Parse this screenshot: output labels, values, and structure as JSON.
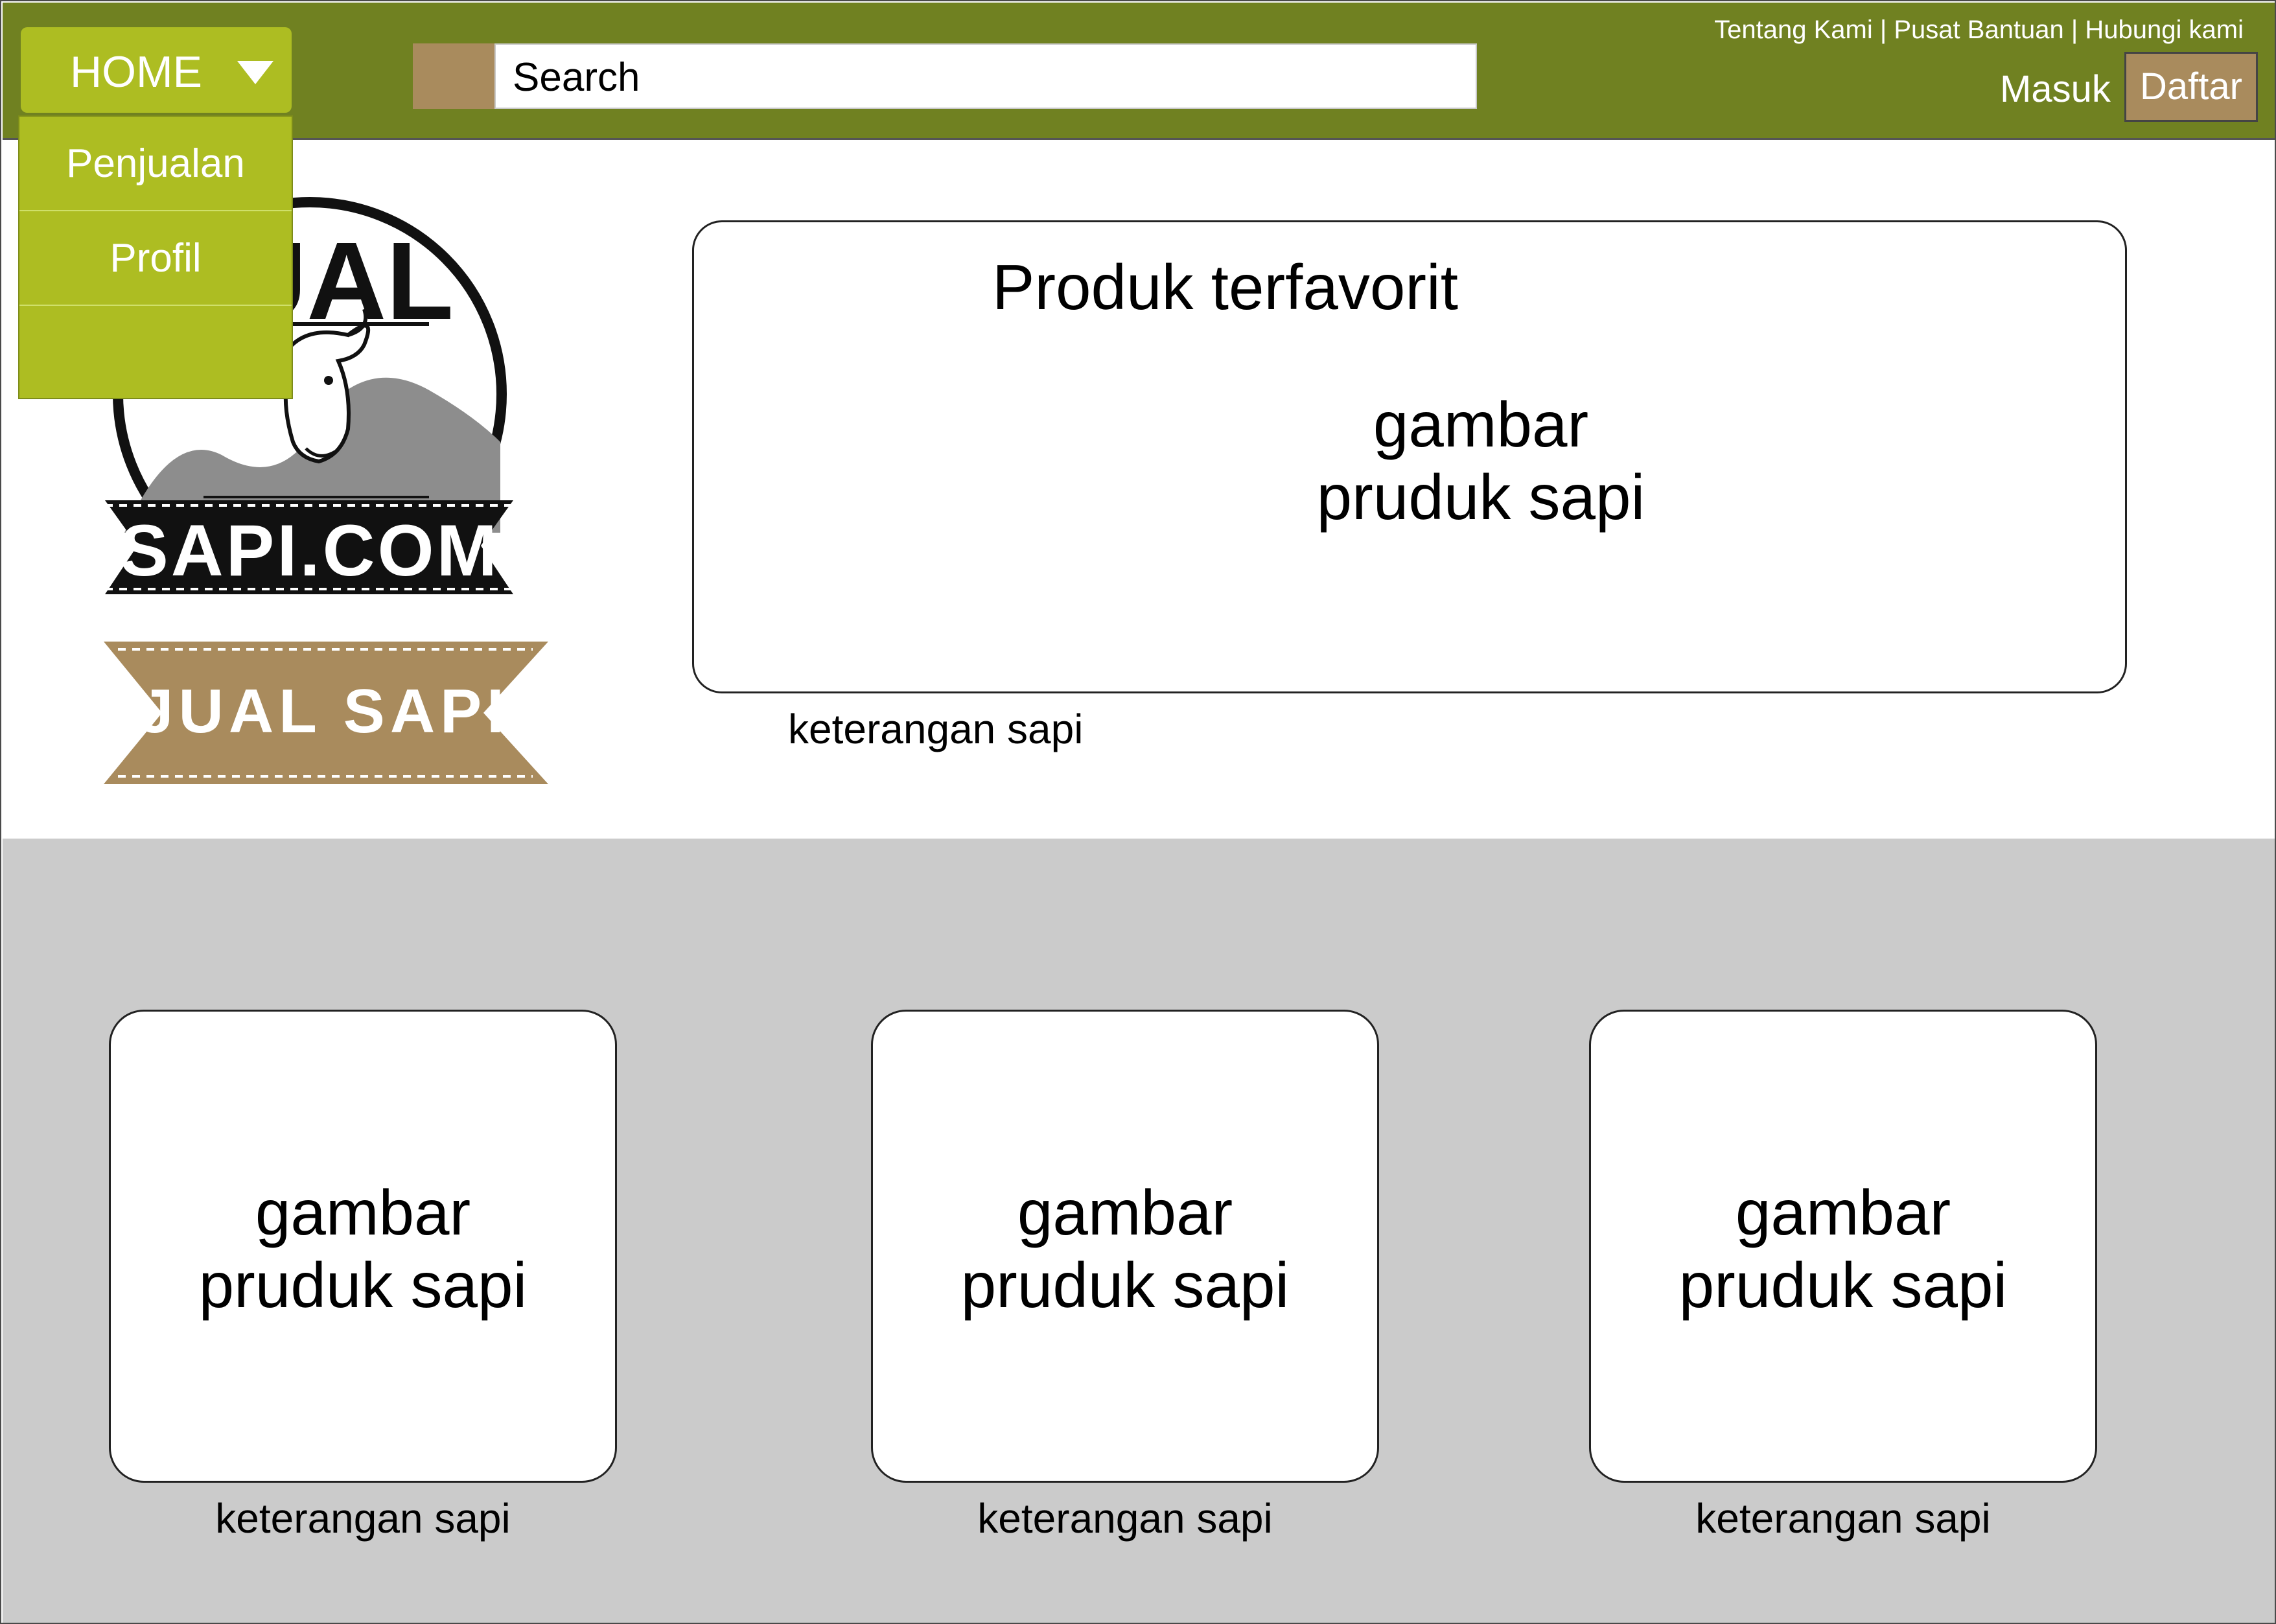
{
  "header": {
    "top_links": [
      "Tentang Kami",
      "Pusat Bantuan",
      "Hubungi kami"
    ],
    "link_separator": " | ",
    "search_placeholder": "Search",
    "login_label": "Masuk",
    "register_label": "Daftar",
    "colors": {
      "bar": "#708121",
      "accent_green": "#adbd22",
      "accent_brown": "#a98b5d"
    }
  },
  "nav": {
    "home_label": "HOME",
    "home_icon": "caret-down-icon",
    "dropdown_items": [
      "Penjualan",
      "Profil",
      ""
    ]
  },
  "logo": {
    "top_text": "JUAL",
    "brand_text": "SAPI.COM",
    "ribbon_text": "JUAL SAPI",
    "icon": "cow-head-icon"
  },
  "featured": {
    "title": "Produk terfavorit",
    "image_line1": "gambar",
    "image_line2": "pruduk sapi",
    "caption": "keterangan sapi"
  },
  "products": [
    {
      "image_line1": "gambar",
      "image_line2": "pruduk sapi",
      "caption": "keterangan sapi"
    },
    {
      "image_line1": "gambar",
      "image_line2": "pruduk sapi",
      "caption": "keterangan sapi"
    },
    {
      "image_line1": "gambar",
      "image_line2": "pruduk sapi",
      "caption": "keterangan sapi"
    }
  ]
}
